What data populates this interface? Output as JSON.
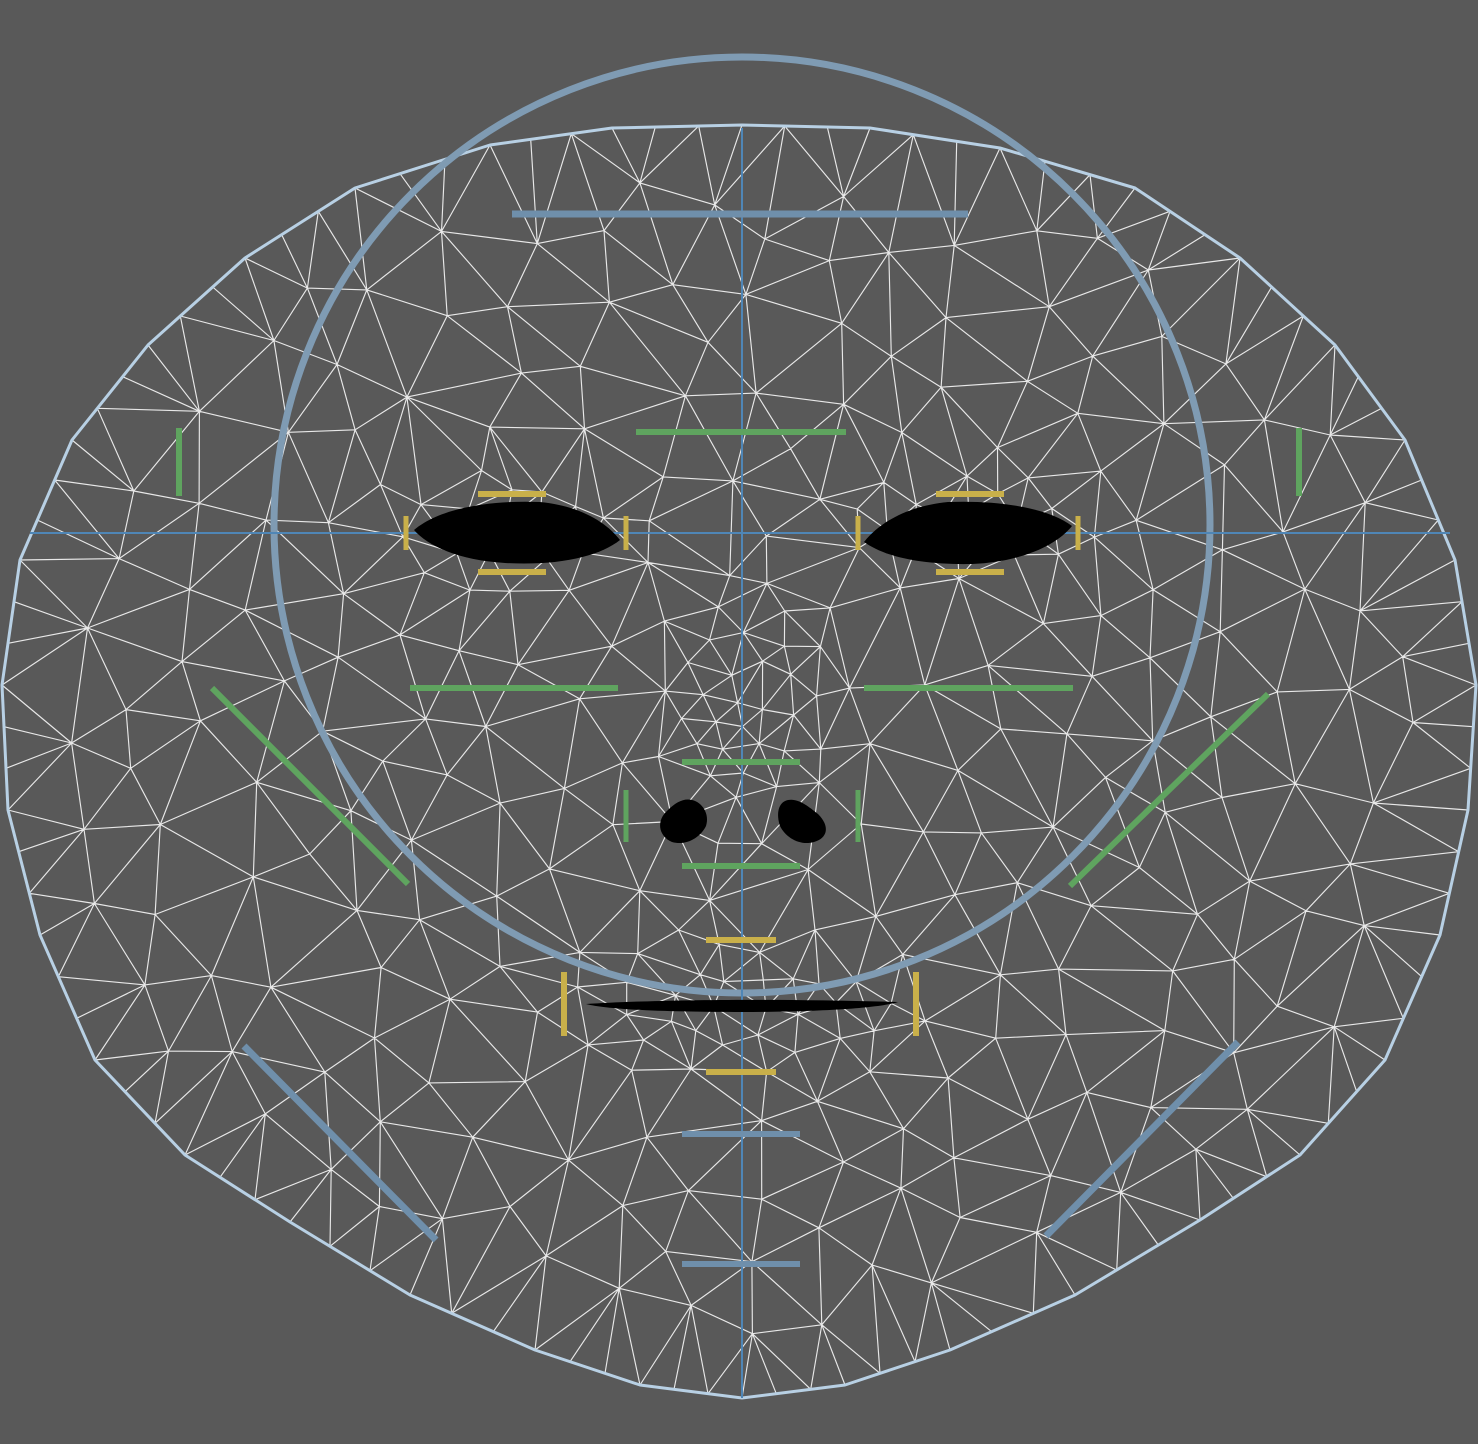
{
  "colors": {
    "background": "#595959",
    "mesh": "#f4f4f4",
    "outline": "#b8d0e4",
    "circle": "#7f9bb3",
    "axis": "#4f86b6",
    "guide_green": "#5fa45f",
    "guide_yellow": "#c9b04a",
    "guide_blue": "#6f8fab",
    "feature_fill": "#000000"
  },
  "icons": {
    "eye": "almond-shape",
    "nostril": "teardrop-shape",
    "mouth": "lip-line"
  }
}
